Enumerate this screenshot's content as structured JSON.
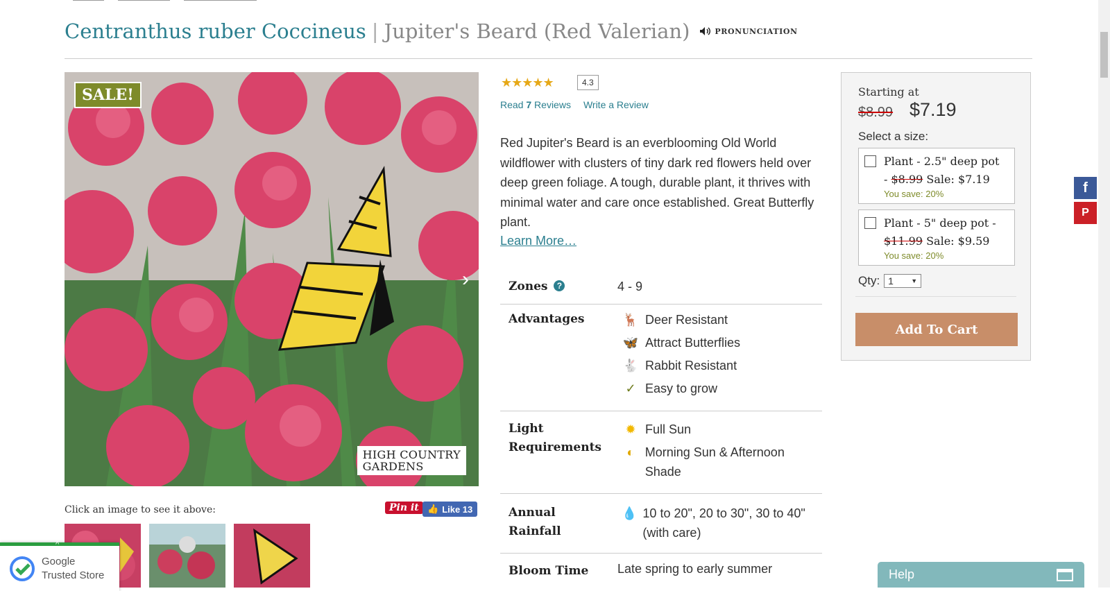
{
  "product": {
    "botanical_name": "Centranthus ruber Coccineus",
    "separator": "|",
    "common_name": "Jupiter's Beard (Red Valerian)",
    "pronunciation_label": "PRONUNCIATION"
  },
  "gallery": {
    "sale_badge": "SALE!",
    "next_arrow": "›",
    "brand_line1": "HIGH COUNTRY",
    "brand_line2": "GARDENS",
    "click_note": "Click an image to see it above:",
    "pinit_label": "Pin it",
    "like_label": "Like 13"
  },
  "rating": {
    "stars_glyph": "★★★★★",
    "value": "4.3",
    "read_prefix": "Read",
    "review_count": "7",
    "read_suffix": "Reviews",
    "write_review": "Write a Review"
  },
  "description": "Red Jupiter's Beard is an everblooming Old World wildflower with clusters of tiny dark red flowers held over deep green foliage. A tough, durable plant, it thrives with minimal water and care once established. Great Butterfly plant.",
  "learn_more": "Learn More…",
  "attributes": {
    "zones": {
      "label": "Zones",
      "help": "?",
      "value": "4 - 9"
    },
    "advantages": {
      "label": "Advantages",
      "items": [
        {
          "icon": "deer-icon",
          "glyph": "🦌",
          "text": "Deer Resistant"
        },
        {
          "icon": "butterfly-icon",
          "glyph": "🦋",
          "text": "Attract Butterflies"
        },
        {
          "icon": "rabbit-icon",
          "glyph": "🐇",
          "text": "Rabbit Resistant"
        },
        {
          "icon": "check-icon",
          "glyph": "✓",
          "text": "Easy to grow"
        }
      ]
    },
    "light": {
      "label_line1": "Light",
      "label_line2": "Requirements",
      "items": [
        {
          "icon": "sun-icon",
          "glyph": "✹",
          "text": "Full Sun"
        },
        {
          "icon": "part-sun-icon",
          "glyph": "◐",
          "text": "Morning Sun & Afternoon Shade"
        }
      ]
    },
    "rainfall": {
      "label_line1": "Annual",
      "label_line2": "Rainfall",
      "icon": "water-drop-icon",
      "glyph": "💧",
      "text": "10 to 20\", 20 to 30\", 30 to 40\" (with care)"
    },
    "bloom": {
      "label": "Bloom Time",
      "value": "Late spring to early summer"
    }
  },
  "buy_box": {
    "starting_at": "Starting at",
    "old_price": "$8.99",
    "new_price": "$7.19",
    "select_size": "Select a size:",
    "options": [
      {
        "name_a": "Plant - 2.5\" deep pot",
        "name_b": "- ",
        "old": "$8.99",
        "sale": " Sale: $7.19",
        "save": "You save: 20%"
      },
      {
        "name_a": "Plant - 5\" deep pot -",
        "name_b": "",
        "old": "$11.99",
        "sale": " Sale: $9.59",
        "save": "You save: 20%"
      }
    ],
    "qty_label": "Qty:",
    "qty_value": "1",
    "add_to_cart": "Add To Cart"
  },
  "social": {
    "facebook": "f",
    "pinterest": "P"
  },
  "google_badge": {
    "line1": "Google",
    "line2": "Trusted Store",
    "caret": "^"
  },
  "help_tab": {
    "label": "Help"
  },
  "colors": {
    "teal": "#2b7f8f",
    "sale_green": "#7e8b2a",
    "cart": "#c88e69",
    "facebook": "#3b5998",
    "pinterest": "#cb2027",
    "help": "#82b8bb"
  }
}
